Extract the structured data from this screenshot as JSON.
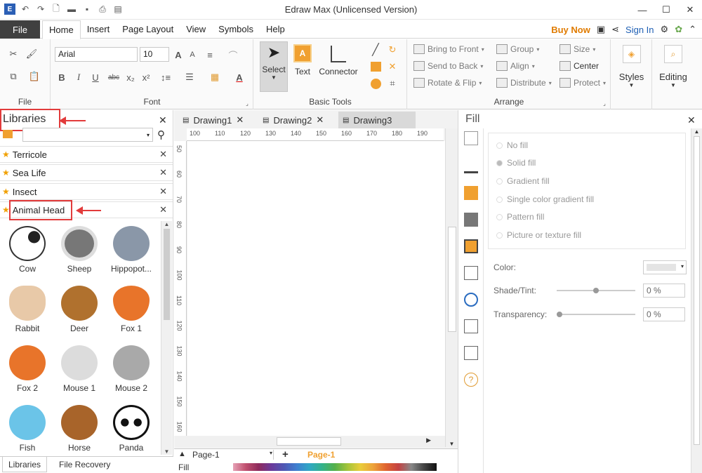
{
  "window": {
    "title": "Edraw Max (Unlicensed Version)"
  },
  "menu": {
    "file": "File",
    "tabs": [
      "Home",
      "Insert",
      "Page Layout",
      "View",
      "Symbols",
      "Help"
    ],
    "buy_now": "Buy Now",
    "sign_in": "Sign In"
  },
  "ribbon": {
    "file_group": "File",
    "font": {
      "name": "Arial",
      "size": "10",
      "label": "Font"
    },
    "basic_tools": {
      "select": "Select",
      "text": "Text",
      "connector": "Connector",
      "label": "Basic Tools"
    },
    "arrange": {
      "bring_to_front": "Bring to Front",
      "send_to_back": "Send to Back",
      "rotate_flip": "Rotate & Flip",
      "group": "Group",
      "align": "Align",
      "distribute": "Distribute",
      "size": "Size",
      "center": "Center",
      "protect": "Protect",
      "label": "Arrange"
    },
    "styles": "Styles",
    "editing": "Editing"
  },
  "libraries": {
    "title": "Libraries",
    "items": [
      "Terricole",
      "Sea Life",
      "Insect",
      "Animal Head"
    ],
    "shapes": [
      "Cow",
      "Sheep",
      "Hippopot...",
      "Rabbit",
      "Deer",
      "Fox 1",
      "Fox 2",
      "Mouse 1",
      "Mouse 2",
      "Fish",
      "Horse",
      "Panda"
    ],
    "bottom_tabs": [
      "Libraries",
      "File Recovery"
    ]
  },
  "documents": {
    "tabs": [
      "Drawing1",
      "Drawing2",
      "Drawing3"
    ],
    "ruler_h": [
      "100",
      "110",
      "120",
      "130",
      "140",
      "150",
      "160",
      "170",
      "180",
      "190"
    ],
    "ruler_v": [
      "50",
      "60",
      "70",
      "80",
      "90",
      "100",
      "110",
      "120",
      "130",
      "140",
      "150",
      "160"
    ],
    "page_select": "Page-1",
    "page_tab": "Page-1",
    "fill_label": "Fill"
  },
  "fill_panel": {
    "title": "Fill",
    "options": [
      "No fill",
      "Solid fill",
      "Gradient fill",
      "Single color gradient fill",
      "Pattern fill",
      "Picture or texture fill"
    ],
    "color_label": "Color:",
    "shade_label": "Shade/Tint:",
    "shade_value": "0 %",
    "transparency_label": "Transparency:",
    "transparency_value": "0 %"
  },
  "colors": {
    "accent_orange": "#f0a030",
    "annotation_red": "#e23b3b",
    "file_tab": "#404040"
  }
}
